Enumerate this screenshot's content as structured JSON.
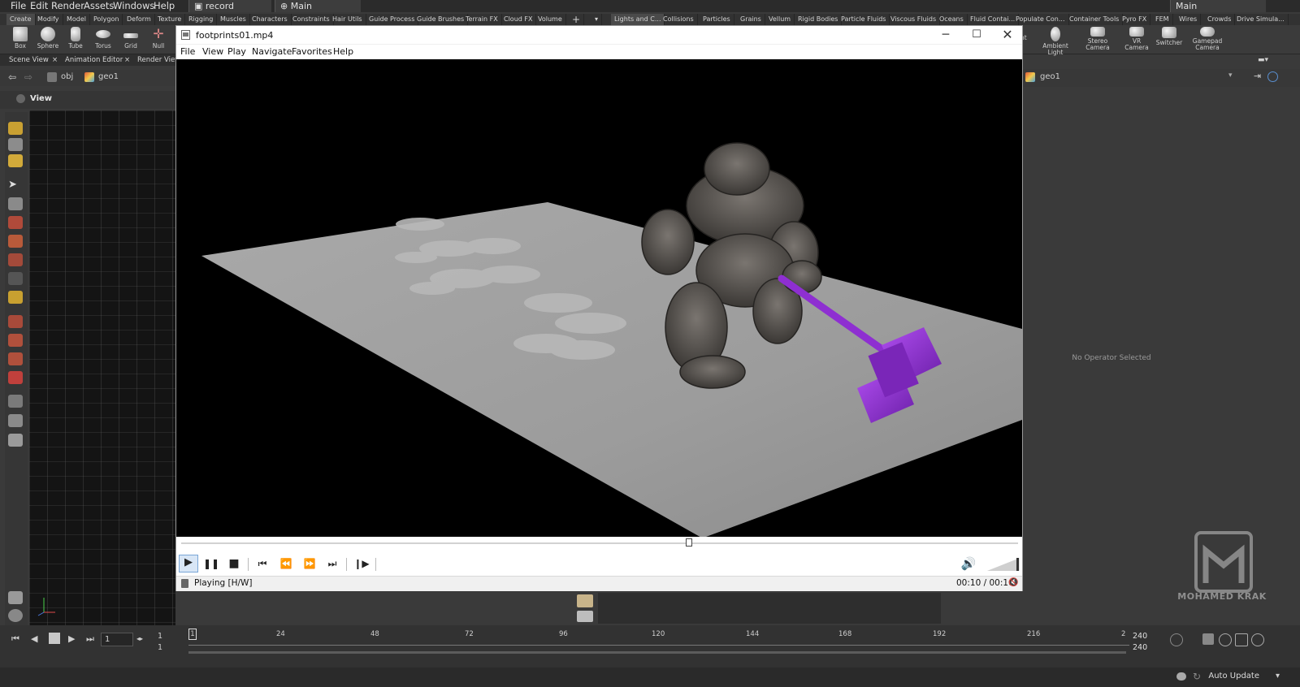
{
  "houdini": {
    "menu": [
      "File",
      "Edit",
      "Render",
      "Assets",
      "Windows",
      "Help"
    ],
    "desktop_select": "record",
    "main_select": "Main",
    "right_select": "Main",
    "shelf_tabs_left": [
      "Create",
      "Modify",
      "Model",
      "Polygon",
      "Deform",
      "Texture",
      "Rigging",
      "Muscles",
      "Characters",
      "Constraints",
      "Hair Utils",
      "Guide Process",
      "Guide Brushes",
      "Terrain FX",
      "Cloud FX",
      "Volume"
    ],
    "shelf_tabs_right": [
      "Lights and C...",
      "Collisions",
      "Particles",
      "Grains",
      "Vellum",
      "Rigid Bodies",
      "Particle Fluids",
      "Viscous Fluids",
      "Oceans",
      "Fluid Contai...",
      "Populate Con...",
      "Container Tools",
      "Pyro FX",
      "FEM",
      "Wires",
      "Crowds",
      "Drive Simula..."
    ],
    "create_tools": [
      "Box",
      "Sphere",
      "Tube",
      "Torus",
      "Grid",
      "Null"
    ],
    "light_tools": [
      "nt",
      "Ambient Light",
      "Stereo Camera",
      "VR Camera",
      "Switcher",
      "Gamepad Camera"
    ],
    "pane_tabs": [
      "Scene View",
      "Animation Editor",
      "Render View"
    ],
    "path_obj": "obj",
    "path_geo": "geo1",
    "view_label": "View",
    "right_path_geo": "geo1",
    "no_operator": "No Operator Selected",
    "logo_text": "MOHAMED KRAK",
    "timeline": {
      "current_frame": "1",
      "start_frame": "1",
      "start_frame2": "1",
      "end_frame": "240",
      "end_frame2": "240",
      "ticks": [
        "1",
        "24",
        "48",
        "72",
        "96",
        "120",
        "144",
        "168",
        "192",
        "216"
      ],
      "tick_end": "2"
    },
    "status_right": "Auto Update"
  },
  "player": {
    "title": "footprints01.mp4",
    "menu": [
      "File",
      "View",
      "Play",
      "Navigate",
      "Favorites",
      "Help"
    ],
    "status": "Playing [H/W]",
    "time": "00:10 / 00:16",
    "progress": 0.607,
    "volume": 0.95,
    "icons": [
      "play-icon",
      "pause-icon",
      "stop-icon",
      "skip-back-icon",
      "rewind-icon",
      "fast-forward-icon",
      "skip-forward-icon",
      "frame-step-icon",
      "volume-icon"
    ]
  },
  "colors": {
    "houdini_bg": "#3a3a3a",
    "player_bg": "#f0f0f0",
    "video_bg": "#000000",
    "hammer": "#8e2fd1"
  }
}
